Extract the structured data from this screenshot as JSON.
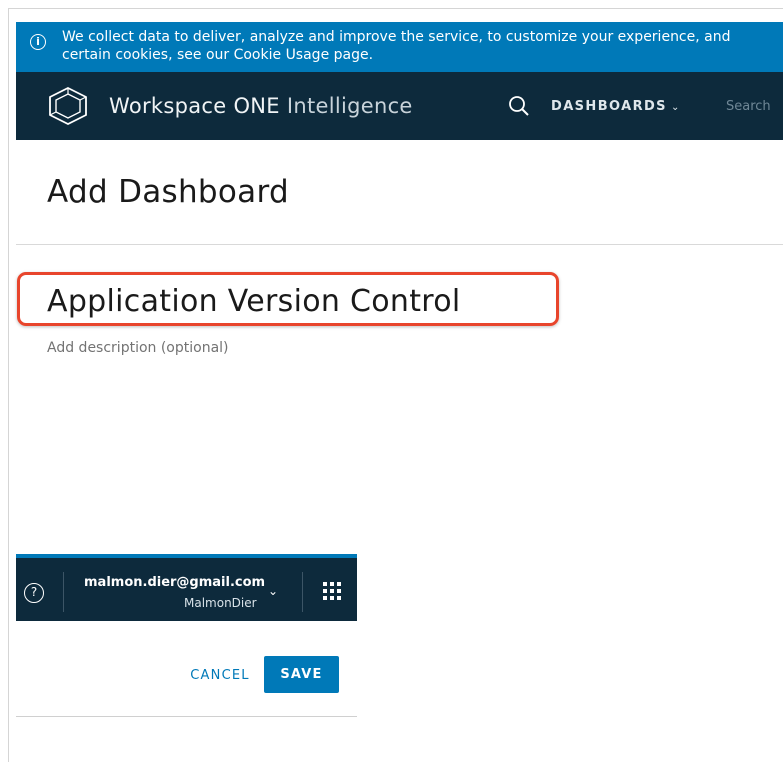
{
  "cookie_banner": {
    "line1": "We collect data to deliver, analyze and improve the service, to customize your experience, and",
    "line2": "certain cookies, see our Cookie Usage page.",
    "icon": "info-icon"
  },
  "header": {
    "app_title_main": "Workspace ONE ",
    "app_title_sub": "Intelligence",
    "nav_dashboards": "DASHBOARDS",
    "search_placeholder": "Search",
    "logo_icon": "hexagon-logo-icon",
    "search_icon": "search-icon"
  },
  "page": {
    "title": "Add Dashboard",
    "dashboard_name": "Application Version Control",
    "description_placeholder": "Add description (optional)"
  },
  "user_bar": {
    "email": "malmon.dier@gmail.com",
    "username": "MalmonDier",
    "help_icon": "help-icon",
    "apps_icon": "apps-grid-icon"
  },
  "actions": {
    "cancel_label": "CANCEL",
    "save_label": "SAVE"
  },
  "colors": {
    "brand_blue": "#0079b8",
    "header_dark": "#0d2a3c",
    "highlight_red": "#e8452c"
  }
}
